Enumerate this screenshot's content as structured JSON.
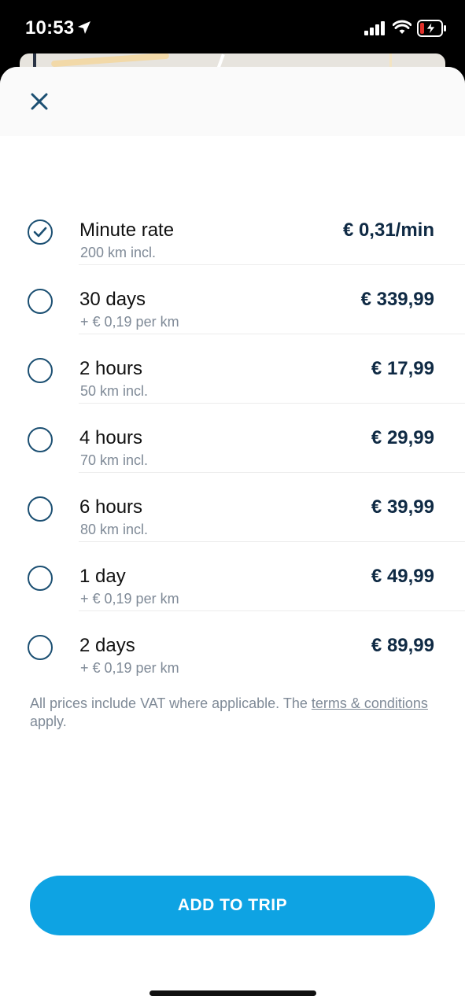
{
  "status_bar": {
    "time": "10:53",
    "icons": [
      "location-arrow-icon",
      "signal-icon",
      "wifi-icon",
      "battery-charging-icon"
    ]
  },
  "header": {
    "close_icon": "close-icon"
  },
  "rates": [
    {
      "title": "Minute rate",
      "subtitle": "200 km incl.",
      "price": "€ 0,31/min",
      "selected": true
    },
    {
      "title": "30 days",
      "subtitle": "+ € 0,19 per km",
      "price": "€ 339,99",
      "selected": false
    },
    {
      "title": "2 hours",
      "subtitle": "50 km incl.",
      "price": "€ 17,99",
      "selected": false
    },
    {
      "title": "4 hours",
      "subtitle": "70 km incl.",
      "price": "€ 29,99",
      "selected": false
    },
    {
      "title": "6 hours",
      "subtitle": "80 km incl.",
      "price": "€ 39,99",
      "selected": false
    },
    {
      "title": "1 day",
      "subtitle": "+ € 0,19 per km",
      "price": "€ 49,99",
      "selected": false
    },
    {
      "title": "2 days",
      "subtitle": "+ € 0,19 per km",
      "price": "€ 89,99",
      "selected": false
    }
  ],
  "note": {
    "prefix": "All prices include VAT where applicable. The ",
    "link": "terms & conditions",
    "suffix": " apply."
  },
  "add_button": {
    "label": "ADD TO TRIP"
  },
  "colors": {
    "accent": "#0ea3e3",
    "radio": "#1b4f72",
    "price": "#0f2a44",
    "muted": "#7f8a97"
  }
}
